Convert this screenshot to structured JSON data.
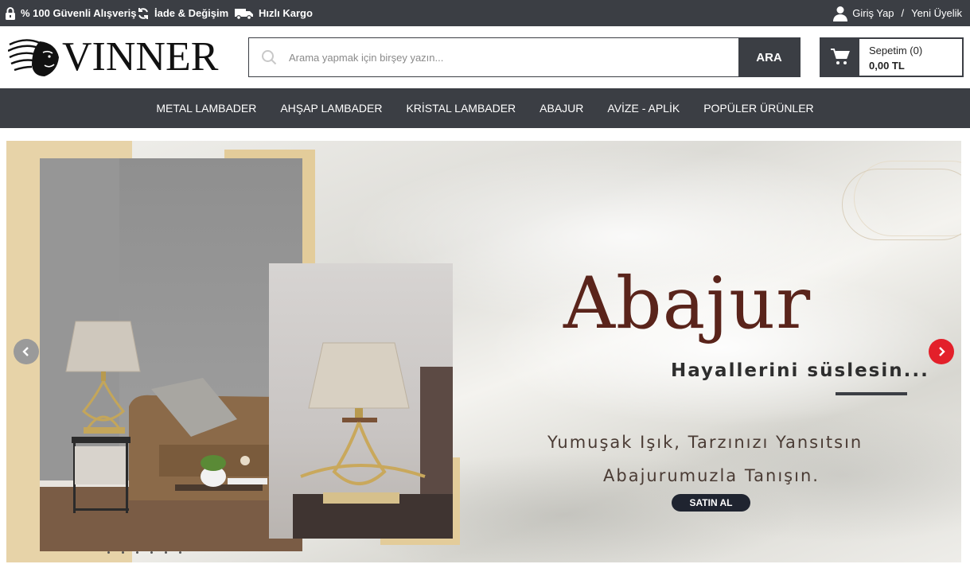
{
  "topbar": {
    "secure_label": "% 100 Güvenli Alışveriş",
    "return_label": "İade & Değişim",
    "shipping_label": "Hızlı Kargo",
    "login_label": "Giriş Yap",
    "separator": "/",
    "register_label": "Yeni Üyelik"
  },
  "header": {
    "logo_text": "VINNER",
    "search_placeholder": "Arama yapmak için birşey yazın...",
    "search_button": "ARA",
    "cart_label": "Sepetim (0)",
    "cart_total": "0,00 TL"
  },
  "nav": {
    "items": [
      "METAL LAMBADER",
      "AHŞAP LAMBADER",
      "KRİSTAL LAMBADER",
      "ABAJUR",
      "AVİZE - APLİK",
      "POPÜLER ÜRÜNLER"
    ]
  },
  "banner": {
    "headline": "Abajur",
    "subheadline": "Hayallerini süslesin...",
    "tagline_1": "Yumuşak Işık, Tarzınızı Yansıtsın",
    "tagline_2": "Abajurumuzla Tanışın.",
    "cta_label": "SATIN AL",
    "slide_count": 6
  },
  "colors": {
    "dark": "#3b3e44",
    "accent_red": "#e3202a",
    "headline": "#5a241b",
    "tan": "#e3cc9a"
  }
}
